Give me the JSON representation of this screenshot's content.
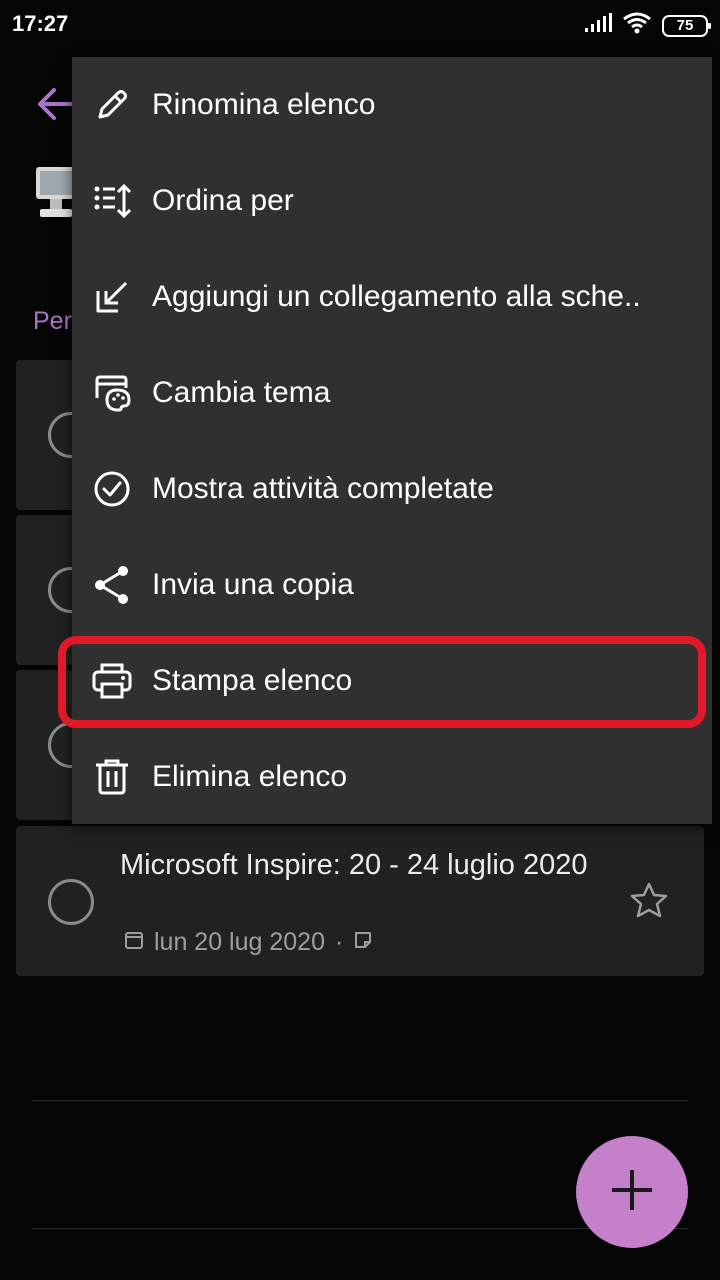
{
  "status_bar": {
    "time": "17:27",
    "battery": "75"
  },
  "page": {
    "section_label": "Per",
    "tasks": [
      {
        "title": "Microsoft Inspire: 20 - 24 luglio 2020",
        "date": "lun 20 lug 2020",
        "separator": "·"
      }
    ]
  },
  "menu": {
    "items": [
      {
        "label": "Rinomina elenco",
        "icon": "pencil-icon"
      },
      {
        "label": "Ordina per",
        "icon": "sort-icon"
      },
      {
        "label": "Aggiungi un collegamento alla sche..",
        "icon": "shortcut-arrow-icon"
      },
      {
        "label": "Cambia tema",
        "icon": "palette-icon"
      },
      {
        "label": "Mostra attività completate",
        "icon": "check-circle-icon"
      },
      {
        "label": "Invia una copia",
        "icon": "share-icon"
      },
      {
        "label": "Stampa elenco",
        "icon": "printer-icon"
      },
      {
        "label": "Elimina elenco",
        "icon": "trash-icon"
      }
    ]
  },
  "colors": {
    "accent": "#a874c8",
    "fab": "#c480c8",
    "highlight": "#e01828",
    "menu_bg": "#303030",
    "card_bg": "#212121"
  }
}
